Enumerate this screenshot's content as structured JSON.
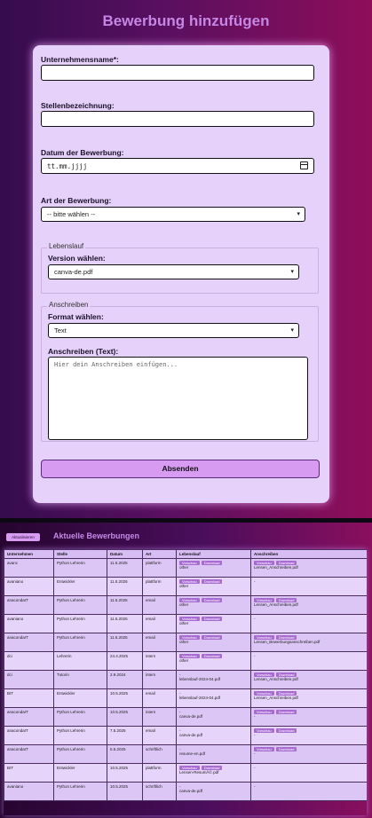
{
  "form": {
    "title": "Bewerbung hinzufügen",
    "company_label": "Unternehmensname*:",
    "company_value": "",
    "position_label": "Stellenbezeichnung:",
    "position_value": "",
    "date_label": "Datum der Bewerbung:",
    "date_placeholder": "tt.mm.jjjj",
    "type_label": "Art der Bewerbung:",
    "type_selected": "-- bitte wählen --",
    "cv_legend": "Lebenslauf",
    "cv_version_label": "Version wählen:",
    "cv_version_selected": "canva-de.pdf",
    "cover_legend": "Anschreiben",
    "cover_format_label": "Format wählen:",
    "cover_format_selected": "Text",
    "cover_text_label": "Anschreiben (Text):",
    "cover_text_placeholder": "Hier dein Anschreiben einfügen...",
    "submit_label": "Absenden"
  },
  "list": {
    "refresh_label": "Aktualisieren",
    "title": "Aktuelle Bewerbungen",
    "columns": [
      "Unternehmen",
      "Stelle",
      "Datum",
      "Art",
      "Lebenslauf",
      "Anschreiben"
    ],
    "preview_label": "Vorschau",
    "download_label": "Download",
    "rows": [
      {
        "company": "avanc",
        "position": "Python Lehrerin",
        "date": "11.5.2025",
        "type": "plattform",
        "cv_file": "other",
        "cv_buttons": true,
        "cover_file": "Lensen_Anschreiben.pdf",
        "cover_buttons": true
      },
      {
        "company": "avaniano",
        "position": "Entwickler",
        "date": "11.5.2025",
        "type": "plattform",
        "cv_file": "other",
        "cv_buttons": true,
        "cover_file": "-",
        "cover_buttons": false
      },
      {
        "company": "anacondaIT",
        "position": "Python Lehrerin",
        "date": "11.5.2025",
        "type": "email",
        "cv_file": "other",
        "cv_buttons": true,
        "cover_file": "Lensen_Anschreiben.pdf",
        "cover_buttons": true
      },
      {
        "company": "avaniano",
        "position": "Python Lehrerin",
        "date": "11.5.2025",
        "type": "email",
        "cv_file": "other",
        "cv_buttons": true,
        "cover_file": "-",
        "cover_buttons": false
      },
      {
        "company": "anacondaIT",
        "position": "Python Lehrerin",
        "date": "11.5.2025",
        "type": "email",
        "cv_file": "other",
        "cv_buttons": true,
        "cover_file": "Lensen_Bewerbungsanschreiben.pdf",
        "cover_buttons": true
      },
      {
        "company": "dci",
        "position": "Lehrerin",
        "date": "24.4.2025",
        "type": "intern",
        "cv_file": "other",
        "cv_buttons": true,
        "cover_file": "-",
        "cover_buttons": false
      },
      {
        "company": "dci",
        "position": "Tutorin",
        "date": "2.9.2024",
        "type": "intern",
        "cv_file": "lebenslauf-2024-04.pdf",
        "cv_buttons": false,
        "cover_file": "Lensen_Anschreiben.pdf",
        "cover_buttons": true
      },
      {
        "company": "BIT",
        "position": "Entwickler",
        "date": "10.5.2025",
        "type": "email",
        "cv_file": "lebenslauf-2024-04.pdf",
        "cv_buttons": false,
        "cover_file": "Lensen_Anschreiben.pdf",
        "cover_buttons": true
      },
      {
        "company": "anacondaIT",
        "position": "Python Lehrerin",
        "date": "10.5.2025",
        "type": "intern",
        "cv_file": "canva-de.pdf",
        "cv_buttons": false,
        "cover_file": "-",
        "cover_buttons": true
      },
      {
        "company": "anacondaIT",
        "position": "Python Lehrerin",
        "date": "7.5.2025",
        "type": "email",
        "cv_file": "canva-de.pdf",
        "cv_buttons": false,
        "cover_file": "-",
        "cover_buttons": true
      },
      {
        "company": "anacondaIT",
        "position": "Python Lehrerin",
        "date": "5.5.2025",
        "type": "schriftlich",
        "cv_file": "resume-en.pdf",
        "cv_buttons": false,
        "cover_file": "-",
        "cover_buttons": true
      },
      {
        "company": "BIT",
        "position": "Entwickler",
        "date": "10.5.2025",
        "type": "plattform",
        "cv_file": "Lensen-ResumÃ©.pdf",
        "cv_buttons": true,
        "cover_file": "-",
        "cover_buttons": false
      },
      {
        "company": "avaniano",
        "position": "Python Lehrerin",
        "date": "10.5.2025",
        "type": "schriftlich",
        "cv_file": "canva-de.pdf",
        "cv_buttons": false,
        "cover_file": "-",
        "cover_buttons": false
      }
    ]
  },
  "colors": {
    "accent": "#d79bf1",
    "card": "#e5d1fa",
    "title": "#c587e6"
  }
}
